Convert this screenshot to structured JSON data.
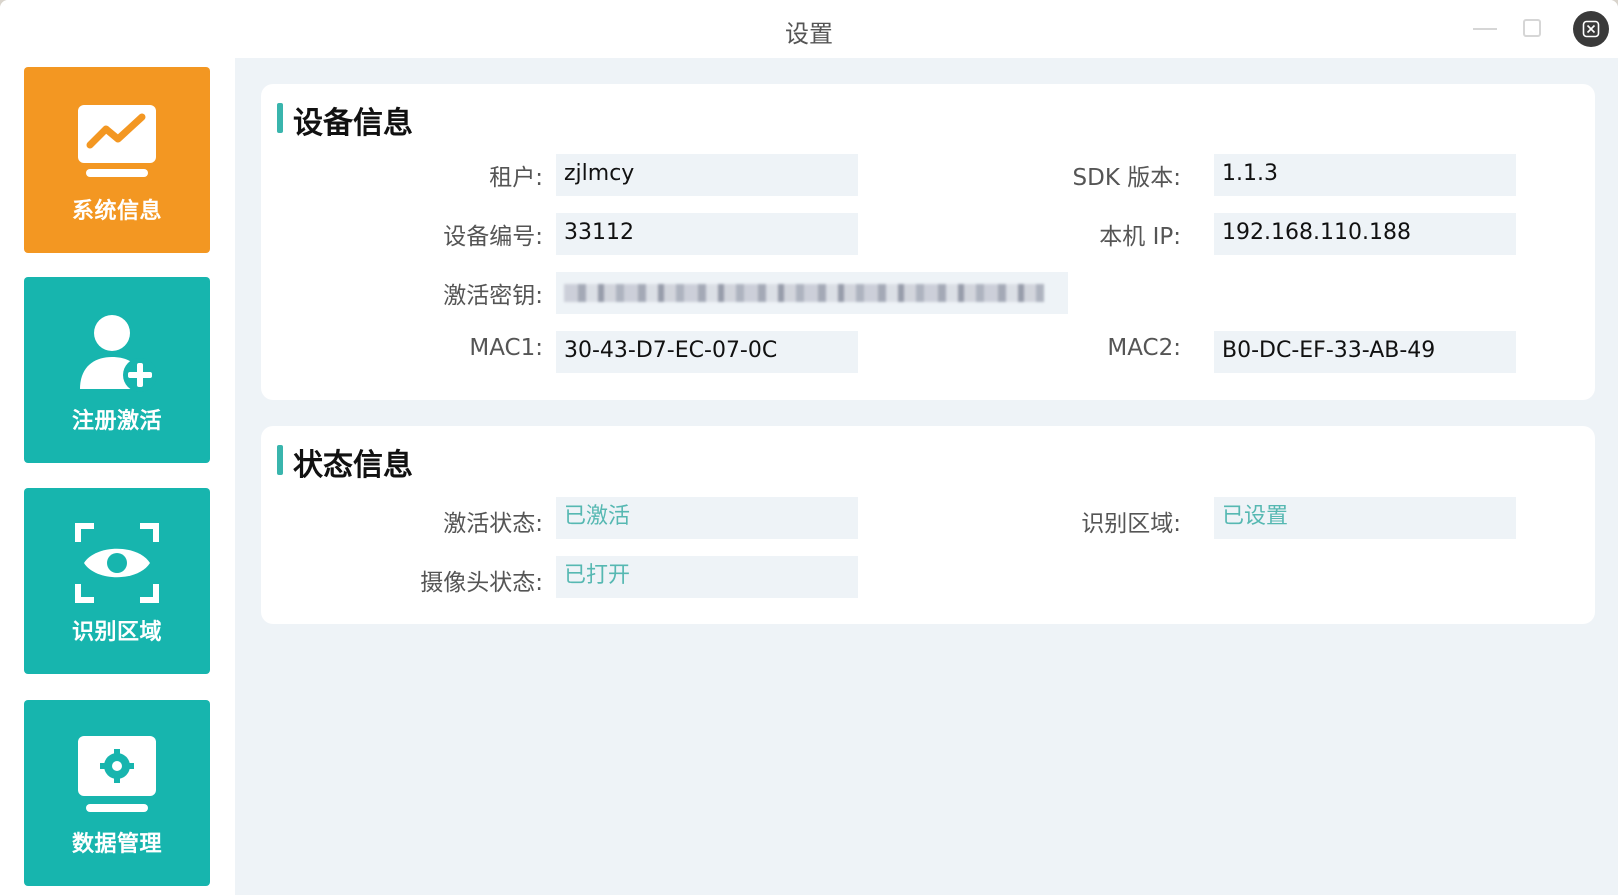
{
  "window": {
    "title": "设置"
  },
  "sidebar": {
    "items": [
      {
        "label": "系统信息",
        "icon": "chart-monitor-icon",
        "active": true
      },
      {
        "label": "注册激活",
        "icon": "user-add-icon",
        "active": false
      },
      {
        "label": "识别区域",
        "icon": "eye-scan-icon",
        "active": false
      },
      {
        "label": "数据管理",
        "icon": "gear-monitor-icon",
        "active": false
      }
    ]
  },
  "device_info": {
    "title": "设备信息",
    "tenant_label": "租户:",
    "tenant_value": "zjlmcy",
    "sdk_label": "SDK 版本:",
    "sdk_value": "1.1.3",
    "device_no_label": "设备编号:",
    "device_no_value": "33112",
    "ip_label": "本机 IP:",
    "ip_value": "192.168.110.188",
    "key_label": "激活密钥:",
    "mac1_label": "MAC1:",
    "mac1_value": "30-43-D7-EC-07-0C",
    "mac2_label": "MAC2:",
    "mac2_value": "B0-DC-EF-33-AB-49"
  },
  "status_info": {
    "title": "状态信息",
    "activation_label": "激活状态:",
    "activation_value": "已激活",
    "region_label": "识别区域:",
    "region_value": "已设置",
    "camera_label": "摄像头状态:",
    "camera_value": "已打开"
  },
  "colors": {
    "active_tile": "#f39722",
    "tile": "#17b5ae",
    "accent": "#39b5ad",
    "status_text": "#56b8b2"
  }
}
